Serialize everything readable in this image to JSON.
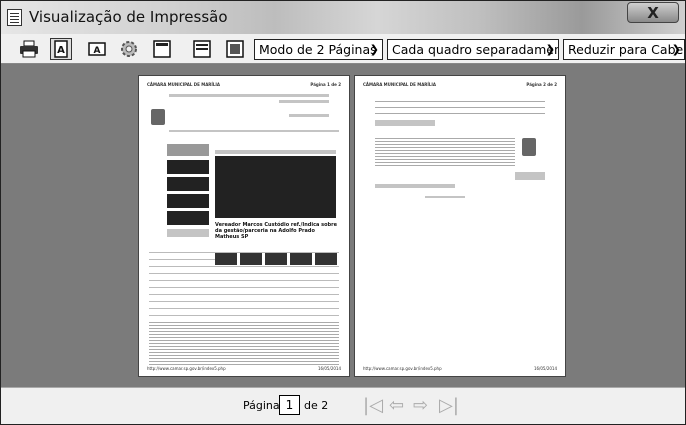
{
  "window": {
    "title": "Visualização de Impressão",
    "close_label": "X"
  },
  "toolbar": {
    "buttons": [
      {
        "name": "print-icon"
      },
      {
        "name": "portrait-icon",
        "glyph": "A"
      },
      {
        "name": "landscape-icon",
        "glyph": "A"
      },
      {
        "name": "page-setup-icon"
      },
      {
        "name": "header-footer-icon"
      },
      {
        "name": "fit-width-icon"
      },
      {
        "name": "full-page-icon"
      }
    ],
    "view_mode": "Modo de 2 Páginas",
    "frames_mode": "Cada quadro separadamente",
    "scale_mode": "Reduzir para Caber"
  },
  "pagination": {
    "label_before": "Página",
    "current": "1",
    "label_after": "de 2"
  },
  "pages": [
    {
      "header_left": "CÂMARA MUNICIPAL DE MARÍLIA",
      "header_right": "Página 1 de 2",
      "headline": "Vereador Marcos Custódio ref./Indica sobre da gestão/parceria na Adolfo Prado Matheus SP",
      "footer_left": "http://www.camar.sp.gov.br/index5.php",
      "footer_right": "16/05/2014"
    },
    {
      "header_left": "CÂMARA MUNICIPAL DE MARÍLIA",
      "header_right": "Página 2 de 2",
      "footer_left": "http://www.camar.sp.gov.br/index5.php",
      "footer_right": "16/05/2014"
    }
  ]
}
